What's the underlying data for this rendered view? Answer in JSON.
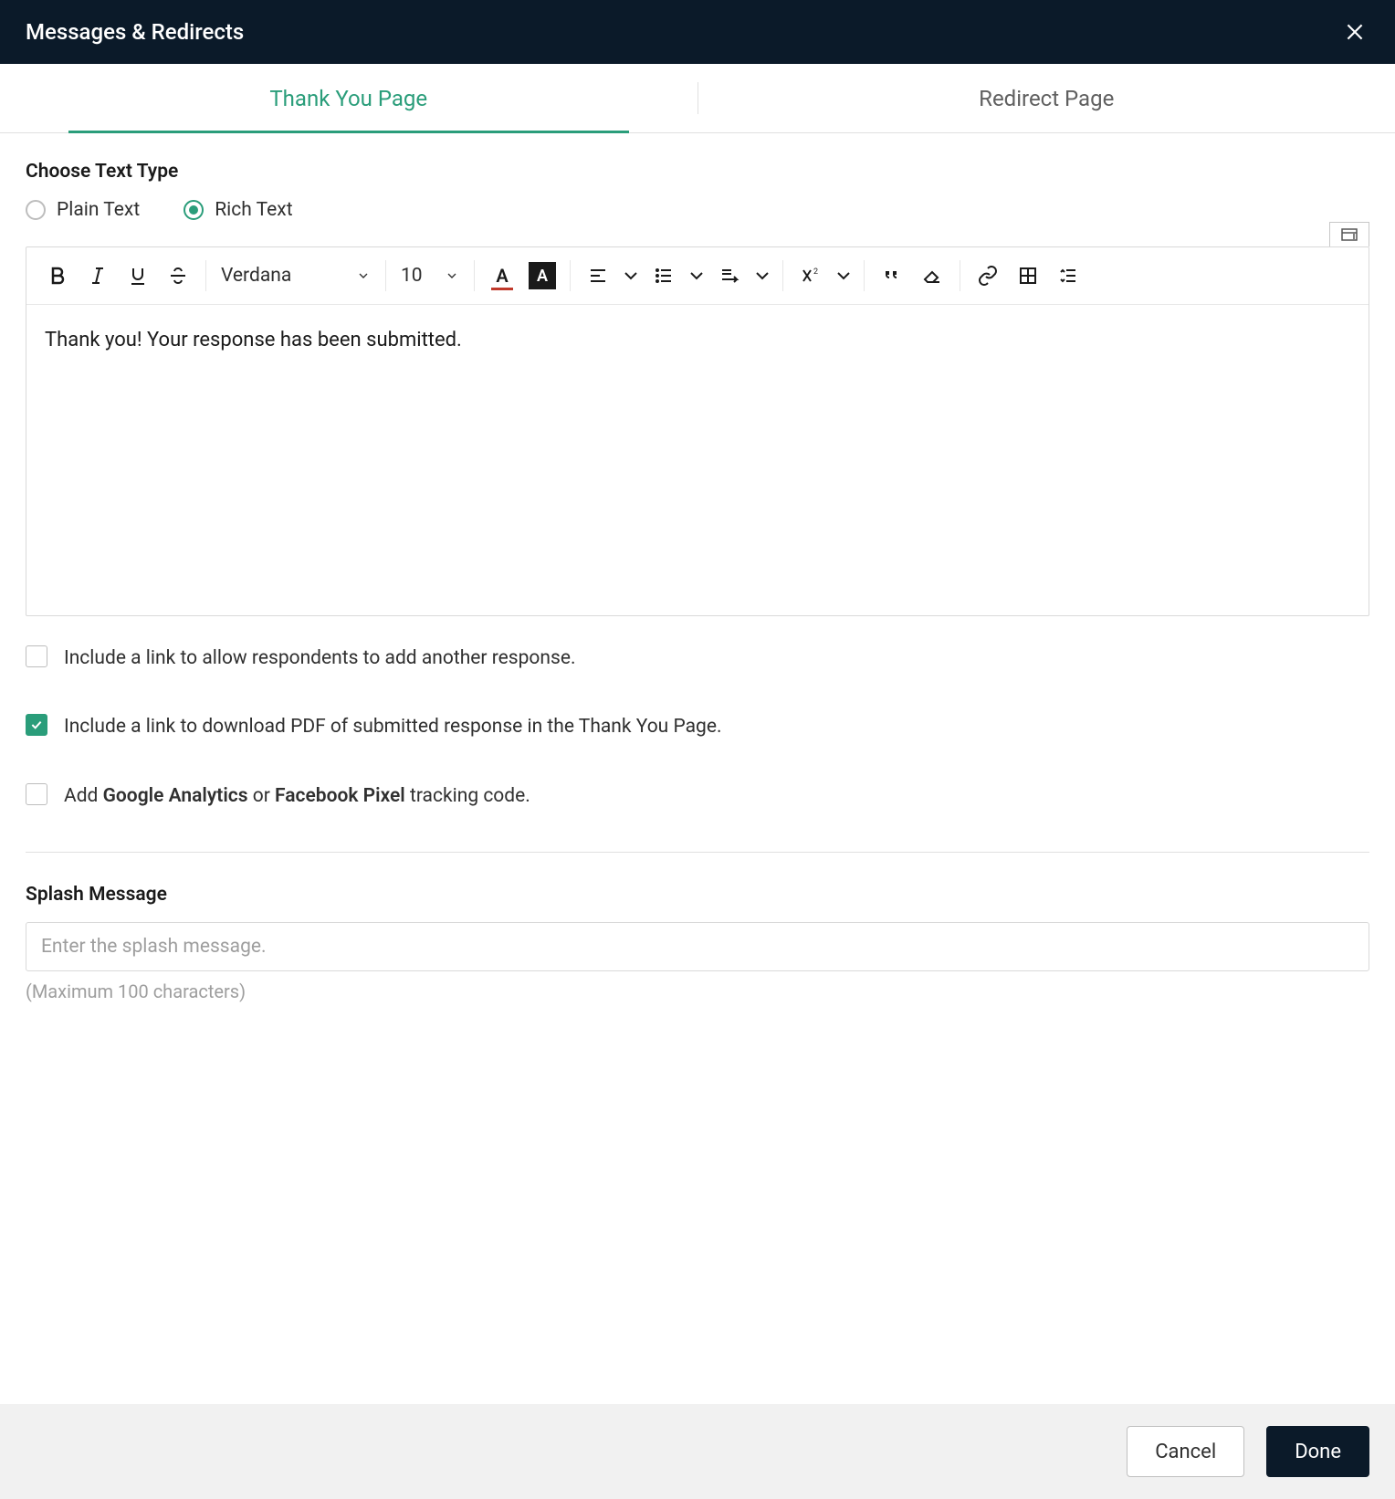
{
  "header": {
    "title": "Messages & Redirects"
  },
  "tabs": {
    "thankyou": "Thank You Page",
    "redirect": "Redirect Page"
  },
  "textType": {
    "label": "Choose Text Type",
    "plain": "Plain Text",
    "rich": "Rich Text",
    "selected": "rich"
  },
  "toolbar": {
    "font": "Verdana",
    "size": "10"
  },
  "editor": {
    "content": "Thank you! Your response has been submitted."
  },
  "checks": {
    "addResponse": "Include a link to allow respondents to add another response.",
    "pdf": "Include a link to download PDF of submitted response in the Thank You Page.",
    "tracking_pre": "Add ",
    "tracking_ga": "Google Analytics",
    "tracking_or": " or ",
    "tracking_fb": "Facebook Pixel",
    "tracking_post": " tracking code."
  },
  "splash": {
    "label": "Splash Message",
    "placeholder": "Enter the splash message.",
    "hint": "(Maximum 100 characters)"
  },
  "footer": {
    "cancel": "Cancel",
    "done": "Done"
  }
}
